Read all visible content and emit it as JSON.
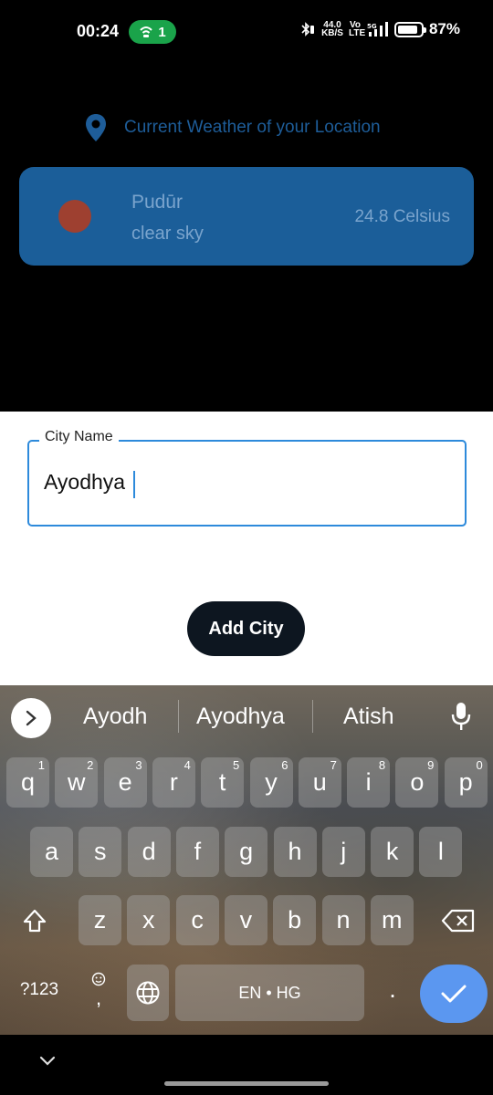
{
  "status_bar": {
    "time": "00:24",
    "hotspot_count": "1",
    "net_speed_value": "44.0",
    "net_speed_unit": "KB/S",
    "volte": "Vo LTE",
    "network": "5G",
    "battery_level": 0.87,
    "battery_text": "87%",
    "hotspot_color": "#1aa34a"
  },
  "location_header": {
    "icon": "location-pin-icon",
    "title": "Current Weather of your Location",
    "color": "#1e5d99"
  },
  "weather_card": {
    "city": "Pudūr",
    "condition": "clear sky",
    "temperature": "24.8 Celsius",
    "background": "#1b5e99",
    "indicator_color": "#9e4030"
  },
  "form": {
    "city_label": "City Name",
    "city_value": "Ayodhya",
    "add_button_label": "Add City",
    "focus_color": "#2d8adb"
  },
  "keyboard": {
    "suggestions": [
      "Ayodh",
      "Ayodhya",
      "Atish"
    ],
    "row1": [
      {
        "label": "q",
        "num": "1"
      },
      {
        "label": "w",
        "num": "2"
      },
      {
        "label": "e",
        "num": "3"
      },
      {
        "label": "r",
        "num": "4"
      },
      {
        "label": "t",
        "num": "5"
      },
      {
        "label": "y",
        "num": "6"
      },
      {
        "label": "u",
        "num": "7"
      },
      {
        "label": "i",
        "num": "8"
      },
      {
        "label": "o",
        "num": "9"
      },
      {
        "label": "p",
        "num": "0"
      }
    ],
    "row2": [
      "a",
      "s",
      "d",
      "f",
      "g",
      "h",
      "j",
      "k",
      "l"
    ],
    "row3": [
      "z",
      "x",
      "c",
      "v",
      "b",
      "n",
      "m"
    ],
    "symbols_label": "?123",
    "comma_label": ",",
    "space_label": "EN • HG",
    "period_label": ".",
    "enter_color": "#5b97f0"
  }
}
